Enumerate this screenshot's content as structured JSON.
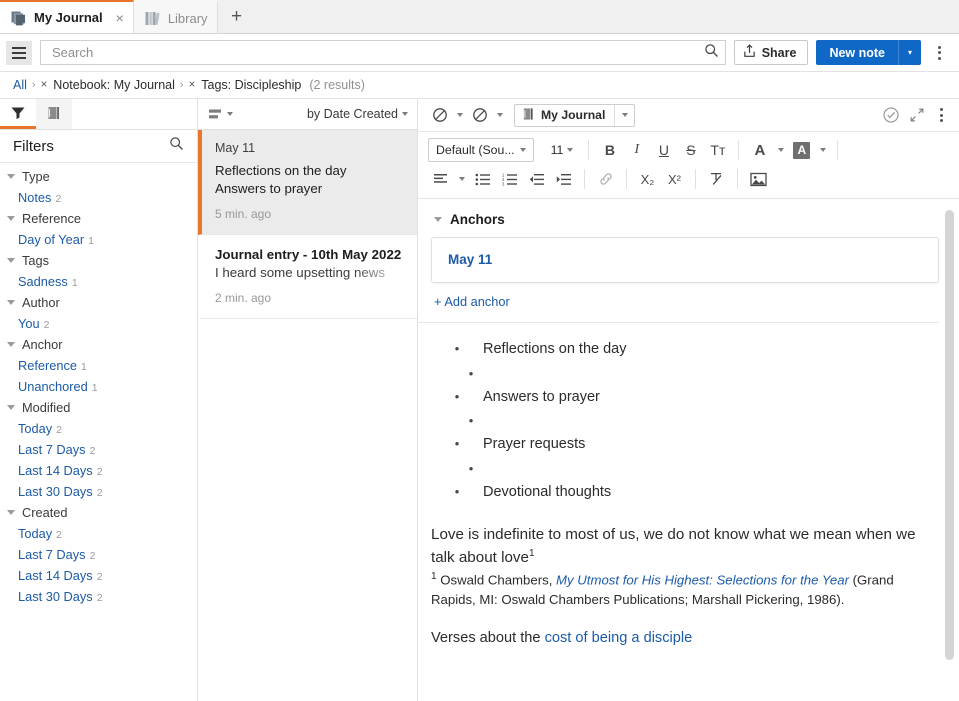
{
  "tabs": [
    {
      "label": "My Journal",
      "icon": "journal-stack-icon",
      "active": true,
      "close": "×"
    },
    {
      "label": "Library",
      "icon": "library-books-icon",
      "active": false
    }
  ],
  "new_tab_label": "+",
  "search": {
    "placeholder": "Search",
    "value": "",
    "icon": "search-icon"
  },
  "toolbar": {
    "menu_icon": "hamburger-icon",
    "share_label": "Share",
    "share_icon": "share-upload-icon",
    "new_note_label": "New note",
    "new_note_caret": "▾",
    "overflow_icon": "kebab-menu-icon"
  },
  "breadcrumb": {
    "root": "All",
    "sep": "›",
    "remove": "×",
    "items": [
      "Notebook: My Journal",
      "Tags: Discipleship"
    ],
    "results": "(2 results)"
  },
  "filters_panel": {
    "tab_filter_icon": "funnel-filter-icon",
    "tab_notebook_icon": "notebook-icon",
    "title": "Filters",
    "search_icon": "search-icon",
    "groups": [
      {
        "label": "Type",
        "items": [
          {
            "label": "Notes",
            "count": "2"
          }
        ]
      },
      {
        "label": "Reference",
        "items": [
          {
            "label": "Day of Year",
            "count": "1"
          }
        ]
      },
      {
        "label": "Tags",
        "items": [
          {
            "label": "Sadness",
            "count": "1"
          }
        ]
      },
      {
        "label": "Author",
        "items": [
          {
            "label": "You",
            "count": "2"
          }
        ]
      },
      {
        "label": "Anchor",
        "items": [
          {
            "label": "Reference",
            "count": "1"
          },
          {
            "label": "Unanchored",
            "count": "1"
          }
        ]
      },
      {
        "label": "Modified",
        "items": [
          {
            "label": "Today",
            "count": "2"
          },
          {
            "label": "Last 7 Days",
            "count": "2"
          },
          {
            "label": "Last 14 Days",
            "count": "2"
          },
          {
            "label": "Last 30 Days",
            "count": "2"
          }
        ]
      },
      {
        "label": "Created",
        "items": [
          {
            "label": "Today",
            "count": "2"
          },
          {
            "label": "Last 7 Days",
            "count": "2"
          },
          {
            "label": "Last 14 Days",
            "count": "2"
          },
          {
            "label": "Last 30 Days",
            "count": "2"
          }
        ]
      }
    ]
  },
  "note_list": {
    "view_icon": "list-view-icon",
    "sort_label": "by Date Created",
    "notes": [
      {
        "date": "May 11",
        "title_line1": "Reflections on the day",
        "title_line2": "Answers to prayer",
        "time": "5 min. ago",
        "selected": true
      },
      {
        "title": "Journal entry - 10th May 2022",
        "snippet": "I heard some upsetting news",
        "time": "2 min. ago",
        "selected": false
      }
    ]
  },
  "editor": {
    "topbar": {
      "no_tag_icon": "no-tag-circle-slash-icon",
      "no_notebook_icon": "no-notebook-circle-slash-icon",
      "notebook_name": "My Journal",
      "notebook_icon": "notebook-icon",
      "caret": "▾",
      "sync_icon": "check-circle-icon",
      "expand_icon": "expand-arrows-icon",
      "overflow_icon": "kebab-menu-icon"
    },
    "format": {
      "font_family": "Default (Sou...",
      "font_size": "11",
      "bold": "B",
      "italic": "I",
      "underline": "U",
      "strikethrough": "S",
      "text_style": "Tᴛ",
      "text_color": "A",
      "highlight_color": "A",
      "align_icon": "align-left-icon",
      "bullet_list_icon": "bullet-list-icon",
      "numbered_list_icon": "numbered-list-icon",
      "outdent_icon": "outdent-icon",
      "indent_icon": "indent-icon",
      "link_icon": "link-icon",
      "subscript": "X₂",
      "superscript": "X²",
      "clear_format_icon": "clear-formatting-icon",
      "image_icon": "insert-image-icon"
    },
    "anchors": {
      "heading": "Anchors",
      "items": [
        {
          "label": "May 11"
        }
      ],
      "add_label": "+ Add anchor"
    },
    "content": {
      "bullets": [
        {
          "text": "Reflections on the day",
          "nested": false
        },
        {
          "text": "",
          "nested": true
        },
        {
          "text": "Answers to prayer",
          "nested": false
        },
        {
          "text": "",
          "nested": true
        },
        {
          "text": "Prayer requests",
          "nested": false
        },
        {
          "text": "",
          "nested": true
        },
        {
          "text": "Devotional thoughts",
          "nested": false
        }
      ],
      "bullet_glyph": "•",
      "paragraph": "Love is indefinite to most of us, we do not know what we mean when we talk about love",
      "paragraph_sup": "1",
      "footnote_marker": "1",
      "footnote_pre": " Oswald Chambers, ",
      "footnote_title": "My Utmost for His Highest: Selections for the Year",
      "footnote_post": " (Grand Rapids, MI: Oswald Chambers Publications; Marshall Pickering, 1986).",
      "closing_pre": "Verses about the ",
      "closing_link": "cost of being a disciple"
    }
  },
  "colors": {
    "accent_orange": "#e8762c",
    "link_blue": "#1c5ba8",
    "primary_button": "#0f68c6"
  }
}
